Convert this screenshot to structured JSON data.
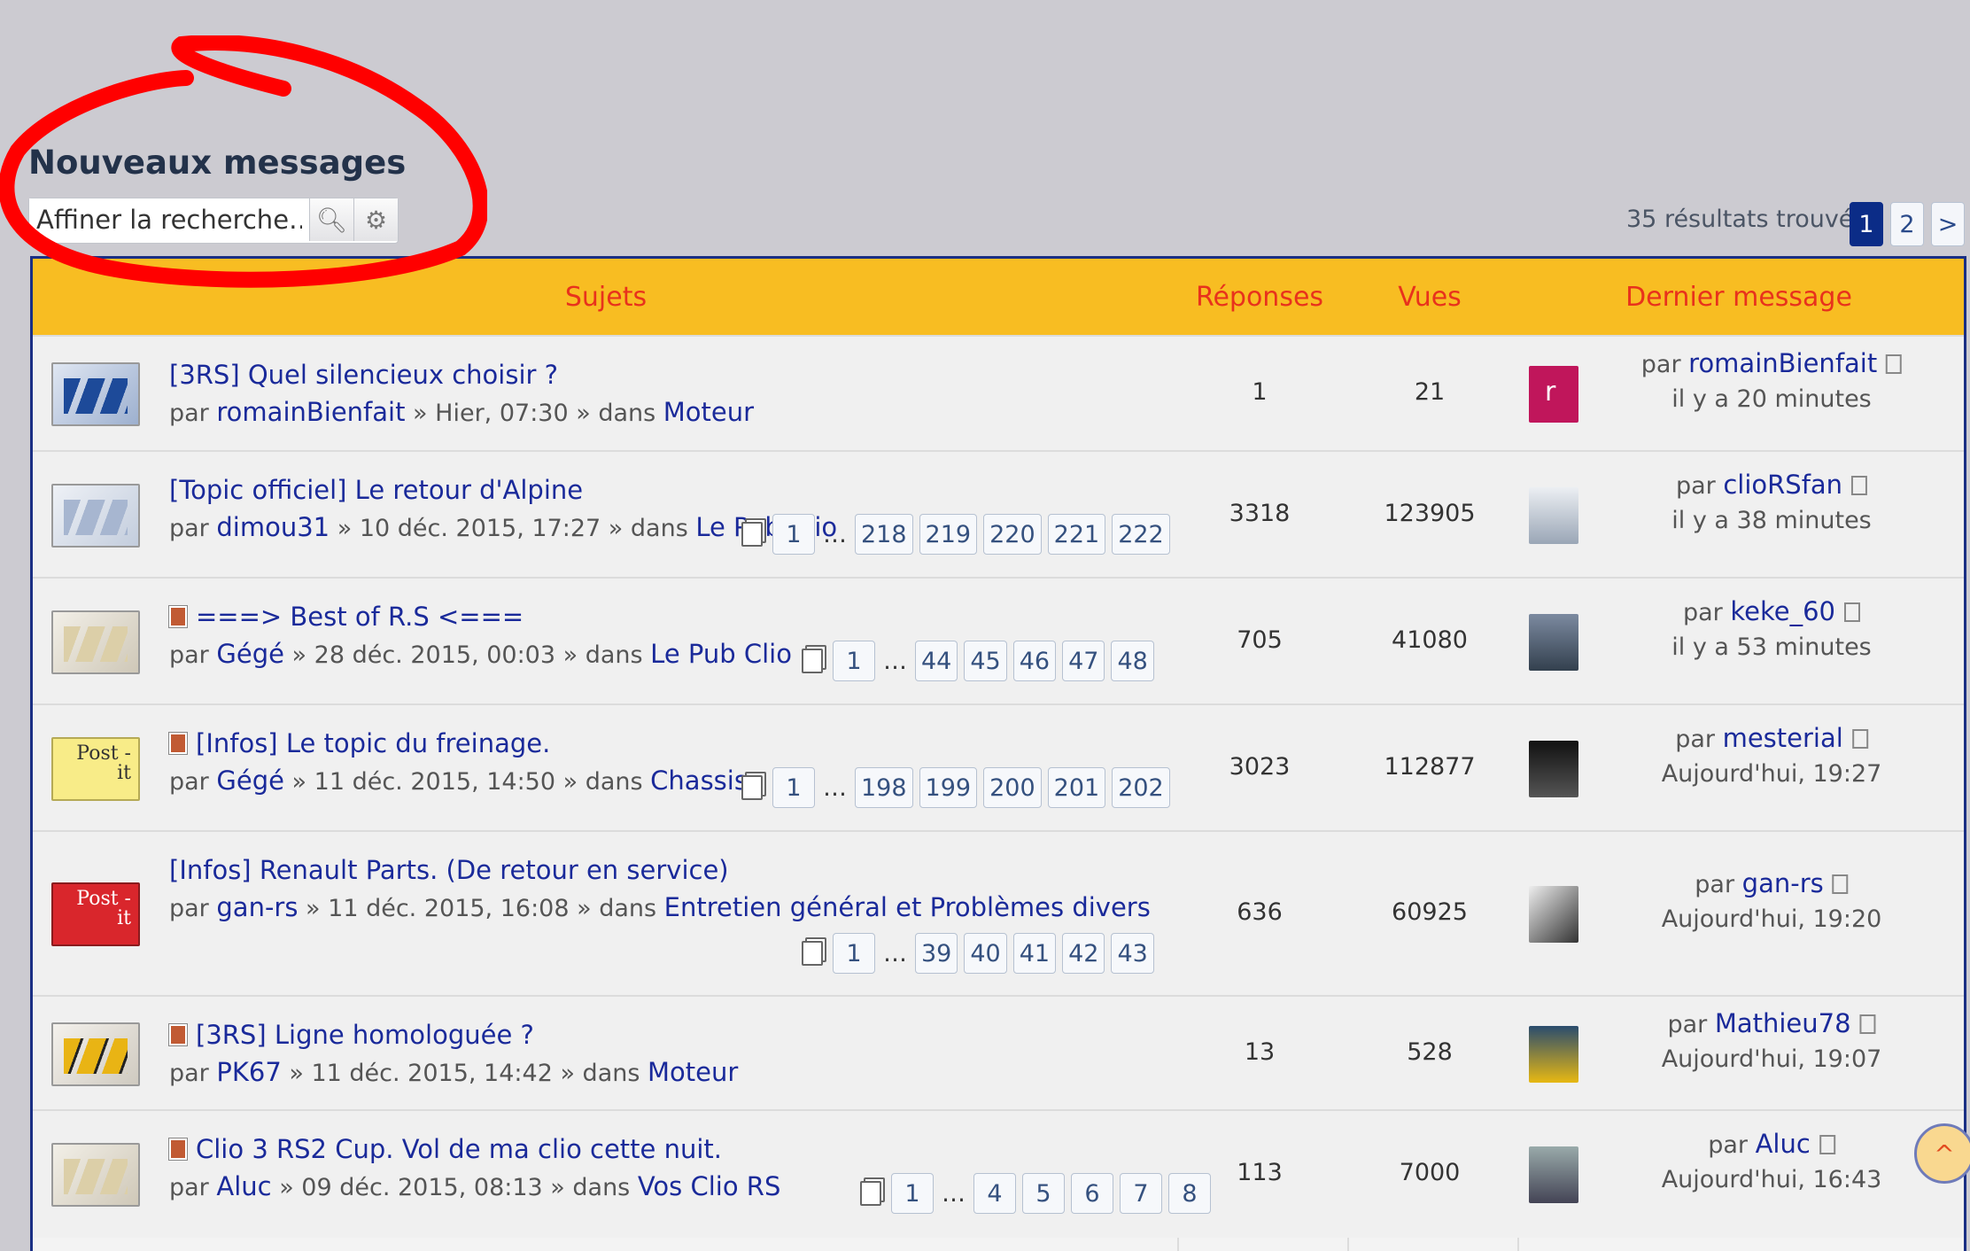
{
  "page_title": "Nouveaux messages",
  "search": {
    "placeholder": "Affiner la recherche…"
  },
  "pagination": {
    "results": "35 résultats trouvés",
    "pages": [
      "1",
      "2"
    ],
    "next": ">"
  },
  "columns": {
    "topics": "Sujets",
    "replies": "Réponses",
    "views": "Vues",
    "last": "Dernier message"
  },
  "by_prefix": "par",
  "topics": [
    {
      "title": "[3RS] Quel silencieux choisir ?",
      "author": "romainBienfait",
      "date": " » Hier, 07:30 » dans ",
      "forum": "Moteur",
      "replies": "1",
      "views": "21",
      "last_author": "romainBienfait",
      "last_time": "il y a 20 minutes",
      "avatar_letter": "r",
      "pages": []
    },
    {
      "title": "[Topic officiel] Le retour d'Alpine",
      "author": "dimou31",
      "date": " » 10 déc. 2015, 17:27 » dans ",
      "forum": "Le Pub Clio",
      "replies": "3318",
      "views": "123905",
      "last_author": "clioRSfan",
      "last_time": "il y a 38 minutes",
      "pages": [
        "1",
        "…",
        "218",
        "219",
        "220",
        "221",
        "222"
      ]
    },
    {
      "title": "===> Best of R.S <===",
      "author": "Gégé",
      "date": " » 28 déc. 2015, 00:03 » dans ",
      "forum": "Le Pub Clio",
      "replies": "705",
      "views": "41080",
      "last_author": "keke_60",
      "last_time": "il y a 53 minutes",
      "pages": [
        "1",
        "…",
        "44",
        "45",
        "46",
        "47",
        "48"
      ]
    },
    {
      "title": "[Infos] Le topic du freinage.",
      "author": "Gégé",
      "date": " » 11 déc. 2015, 14:50 » dans ",
      "forum": "Chassis",
      "replies": "3023",
      "views": "112877",
      "last_author": "mesterial",
      "last_time": "Aujourd'hui, 19:27",
      "icon_text": "Post - it",
      "pages": [
        "1",
        "…",
        "198",
        "199",
        "200",
        "201",
        "202"
      ]
    },
    {
      "title": "[Infos] Renault Parts. (De retour en service)",
      "author": "gan-rs",
      "date": " » 11 déc. 2015, 16:08 » dans ",
      "forum": "Entretien général et Problèmes divers",
      "replies": "636",
      "views": "60925",
      "last_author": "gan-rs",
      "last_time": "Aujourd'hui, 19:20",
      "icon_text": "Post - it",
      "pages": [
        "1",
        "…",
        "39",
        "40",
        "41",
        "42",
        "43"
      ]
    },
    {
      "title": "[3RS] Ligne homologuée ?",
      "author": "PK67",
      "date": " » 11 déc. 2015, 14:42 » dans ",
      "forum": "Moteur",
      "replies": "13",
      "views": "528",
      "last_author": "Mathieu78",
      "last_time": "Aujourd'hui, 19:07",
      "pages": []
    },
    {
      "title": "Clio 3 RS2 Cup. Vol de ma clio cette nuit.",
      "author": "Aluc",
      "date": " » 09 déc. 2015, 08:13 » dans ",
      "forum": "Vos Clio RS",
      "replies": "113",
      "views": "7000",
      "last_author": "Aluc",
      "last_time": "Aujourd'hui, 16:43",
      "pages": [
        "1",
        "…",
        "4",
        "5",
        "6",
        "7",
        "8"
      ]
    }
  ],
  "colors": {
    "header_bg": "#f8bd22",
    "header_text": "#e8321c",
    "link": "#1a2a9a",
    "border": "#1a2f84",
    "annotation": "#ff0000",
    "page_active": "#0b2c87"
  },
  "icons": {
    "search": "search-icon",
    "settings": "gear-icon",
    "pages": "pages-icon",
    "goto": "goto-post-icon",
    "unread": "unread-edit-icon",
    "top": "chevron-up-icon"
  }
}
